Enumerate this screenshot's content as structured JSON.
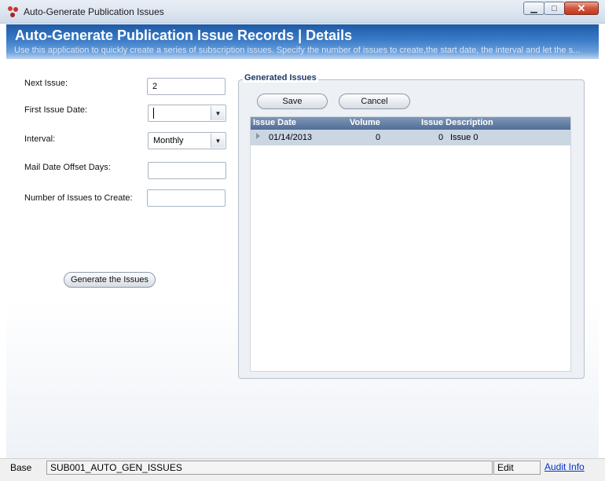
{
  "window": {
    "title": "Auto-Generate Publication Issues"
  },
  "header": {
    "title": "Auto-Generate Publication Issue Records  |  Details",
    "subtitle": "Use this application to quickly create a series of subscription issues. Specify the number of issues to create,the start date, the interval and let the s..."
  },
  "form": {
    "next_issue_label": "Next Issue:",
    "next_issue_value": "2",
    "first_issue_date_label": "First Issue Date:",
    "first_issue_date_value": "",
    "interval_label": "Interval:",
    "interval_value": "Monthly",
    "mail_offset_label": "Mail Date Offset Days:",
    "mail_offset_value": "",
    "num_issues_label": "Number of Issues to Create:",
    "num_issues_value": "",
    "generate_button": "Generate the Issues"
  },
  "generated": {
    "group_title": "Generated Issues",
    "save_button": "Save",
    "cancel_button": "Cancel",
    "columns": [
      "Issue Date",
      "Volume",
      "Issue Description"
    ],
    "rows": [
      {
        "issue_date": "01/14/2013",
        "volume": "0",
        "issue_num": "0",
        "description": "Issue 0"
      }
    ]
  },
  "status": {
    "base": "Base",
    "code": "SUB001_AUTO_GEN_ISSUES",
    "mode": "Edit",
    "audit": "Audit Info"
  },
  "colors": {
    "header_blue": "#1e5aa6",
    "grid_header": "#4f6d96",
    "row_selected": "#cbd6e3",
    "link": "#0033cc"
  }
}
